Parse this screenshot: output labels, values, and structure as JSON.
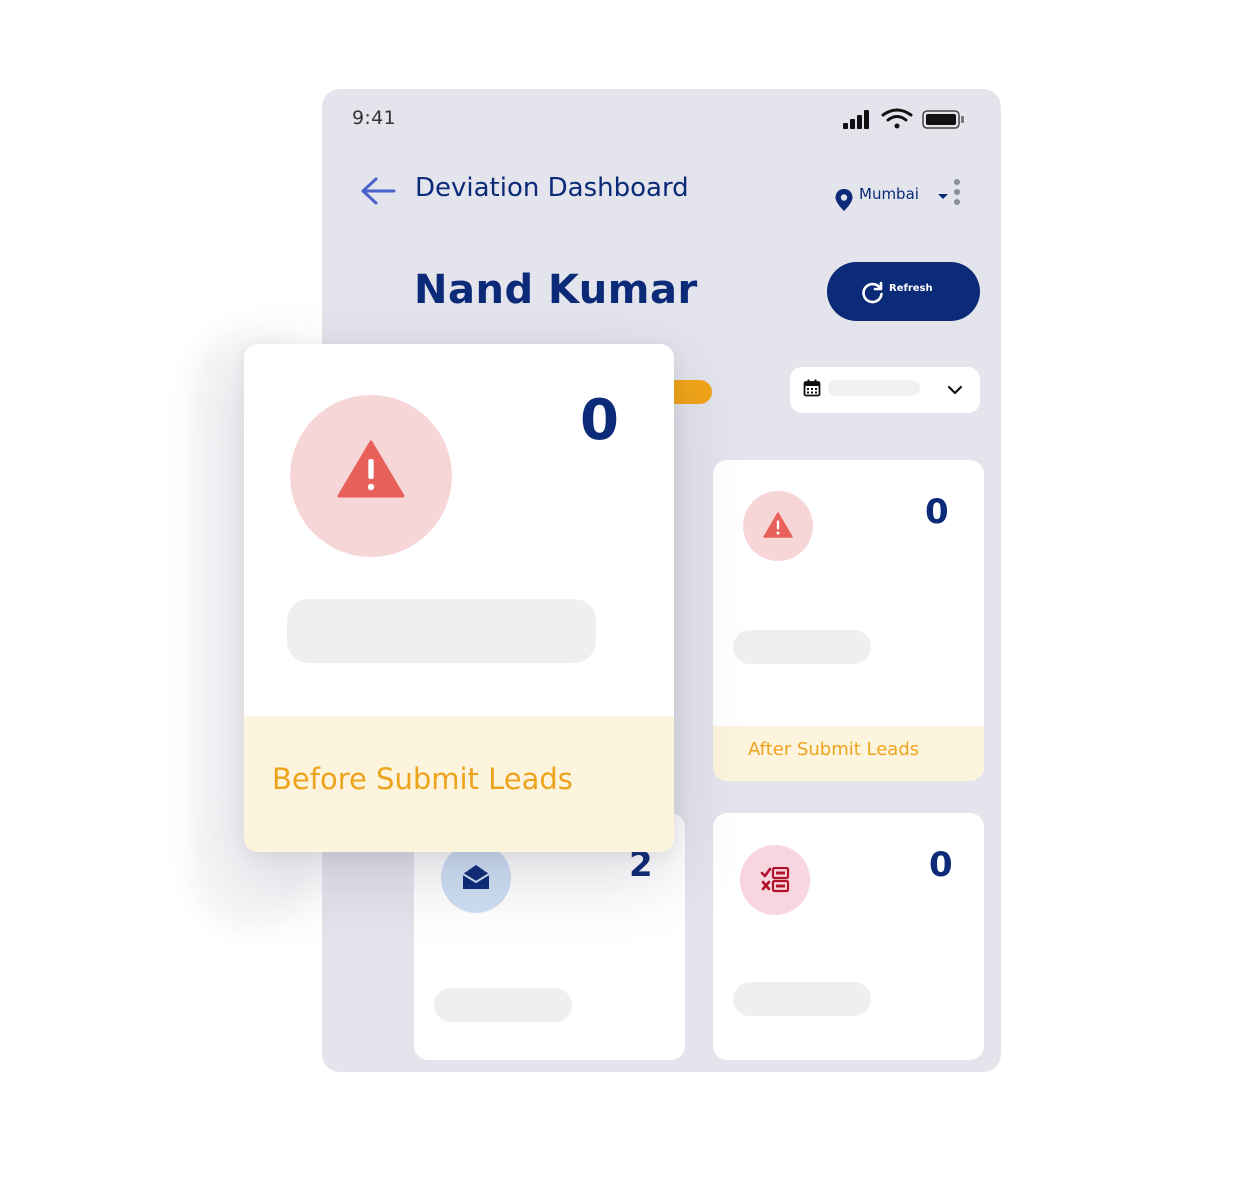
{
  "status_bar": {
    "time": "9:41"
  },
  "header": {
    "title": "Deviation Dashboard",
    "location": "Mumbai"
  },
  "user": {
    "name": "Nand Kumar"
  },
  "refresh": {
    "label": "Refresh"
  },
  "cards": {
    "before_submit": {
      "count": "0",
      "label": "Before Submit Leads",
      "icon": "warning-icon",
      "icon_color": "#e8605a",
      "icon_bg": "#f7d6d8"
    },
    "after_submit": {
      "count": "0",
      "label": "After Submit Leads",
      "icon": "warning-icon",
      "icon_color": "#e8605a",
      "icon_bg": "#f7d6d8"
    },
    "mail": {
      "count": "2",
      "icon": "open-envelope-icon",
      "icon_color": "#0b2a78",
      "icon_bg": "#cfe0f4"
    },
    "checklist": {
      "count": "0",
      "icon": "checklist-icon",
      "icon_color": "#b0122a",
      "icon_bg": "#f9d6df"
    }
  },
  "colors": {
    "primary": "#0b2a78",
    "accent": "#f2a516",
    "label": "#eea31d",
    "label_bg": "#fdf4dd",
    "phone_bg": "#e3e4ec"
  }
}
